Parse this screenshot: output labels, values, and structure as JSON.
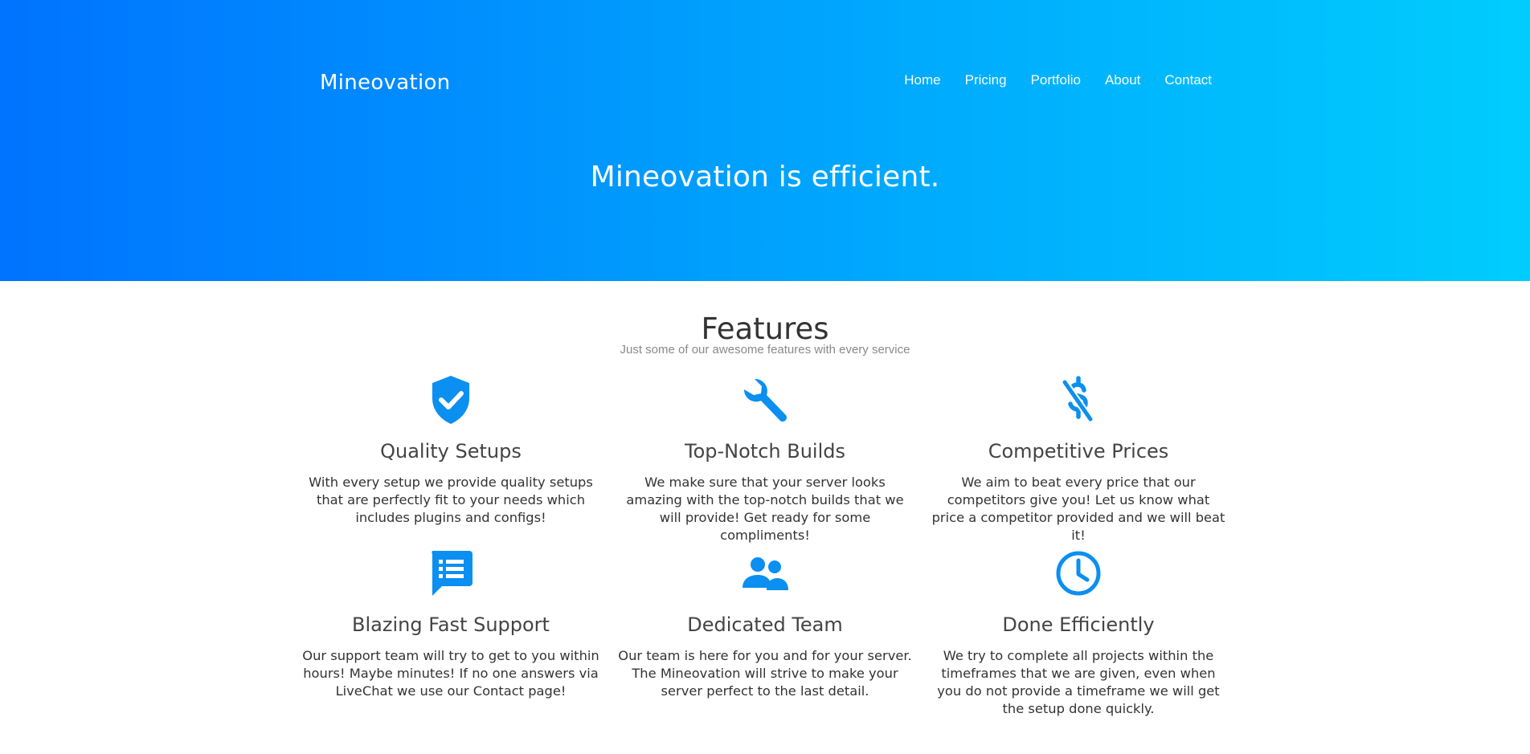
{
  "header": {
    "brand": "Mineovation",
    "nav": [
      {
        "label": "Home"
      },
      {
        "label": "Pricing"
      },
      {
        "label": "Portfolio"
      },
      {
        "label": "About"
      },
      {
        "label": "Contact"
      }
    ],
    "hero_title": "Mineovation is efficient."
  },
  "colors": {
    "gradient_start": "#0073fe",
    "gradient_end": "#00cdfd",
    "icon_blue": "#0b8ff0"
  },
  "features": {
    "title": "Features",
    "subtitle": "Just some of our awesome features with every service",
    "items": [
      {
        "icon": "shield-check-icon",
        "title": "Quality Setups",
        "text": "With every setup we provide quality setups that are perfectly fit to your needs which includes plugins and configs!"
      },
      {
        "icon": "wrench-icon",
        "title": "Top-Notch Builds",
        "text": "We make sure that your server looks amazing with the top-notch builds that we will provide! Get ready for some compliments!"
      },
      {
        "icon": "money-off-icon",
        "title": "Competitive Prices",
        "text": "We aim to beat every price that our competitors give you! Let us know what price a competitor provided and we will beat it!"
      },
      {
        "icon": "chat-list-icon",
        "title": "Blazing Fast Support",
        "text": "Our support team will try to get to you within hours! Maybe minutes! If no one answers via LiveChat we use our Contact page!"
      },
      {
        "icon": "team-icon",
        "title": "Dedicated Team",
        "text": "Our team is here for you and for your server. The Mineovation will strive to make your server perfect to the last detail."
      },
      {
        "icon": "clock-icon",
        "title": "Done Efficiently",
        "text": "We try to complete all projects within the timeframes that we are given, even when you do not provide a timeframe we will get the setup done quickly."
      }
    ]
  }
}
